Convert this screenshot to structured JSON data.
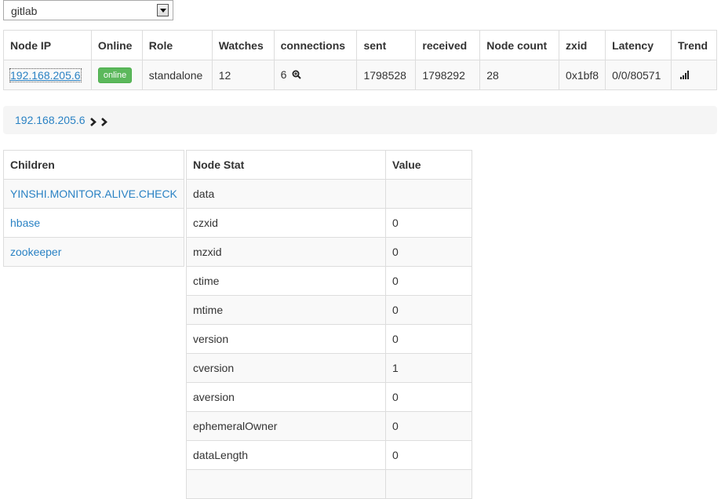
{
  "cluster_select": {
    "value": "gitlab"
  },
  "server_table": {
    "headers": [
      "Node IP",
      "Online",
      "Role",
      "Watches",
      "connections",
      "sent",
      "received",
      "Node count",
      "zxid",
      "Latency",
      "Trend"
    ],
    "row": {
      "node_ip": "192.168.205.6",
      "online": "online",
      "role": "standalone",
      "watches": "12",
      "connections": "6",
      "sent": "1798528",
      "received": "1798292",
      "node_count": "28",
      "zxid": "0x1bf8",
      "latency": "0/0/80571"
    }
  },
  "breadcrumb": {
    "path": "192.168.205.6"
  },
  "children": {
    "header": "Children",
    "items": [
      "YINSHI.MONITOR.ALIVE.CHECK",
      "hbase",
      "zookeeper"
    ]
  },
  "node_stat": {
    "headers": [
      "Node Stat",
      "Value"
    ],
    "rows": [
      {
        "name": "data",
        "value": ""
      },
      {
        "name": "czxid",
        "value": "0"
      },
      {
        "name": "mzxid",
        "value": "0"
      },
      {
        "name": "ctime",
        "value": "0"
      },
      {
        "name": "mtime",
        "value": "0"
      },
      {
        "name": "version",
        "value": "0"
      },
      {
        "name": "cversion",
        "value": "1"
      },
      {
        "name": "aversion",
        "value": "0"
      },
      {
        "name": "ephemeralOwner",
        "value": "0"
      },
      {
        "name": "dataLength",
        "value": "0"
      },
      {
        "name": "",
        "value": ""
      }
    ]
  },
  "icons": {
    "zoom": "zoom-in-icon",
    "trend": "signal-bars-icon",
    "chevron": "chevron-right-icon"
  },
  "colors": {
    "link": "#2a82c4",
    "online": "#5cb85c",
    "breadcrumb_bg": "#f5f5f5"
  }
}
